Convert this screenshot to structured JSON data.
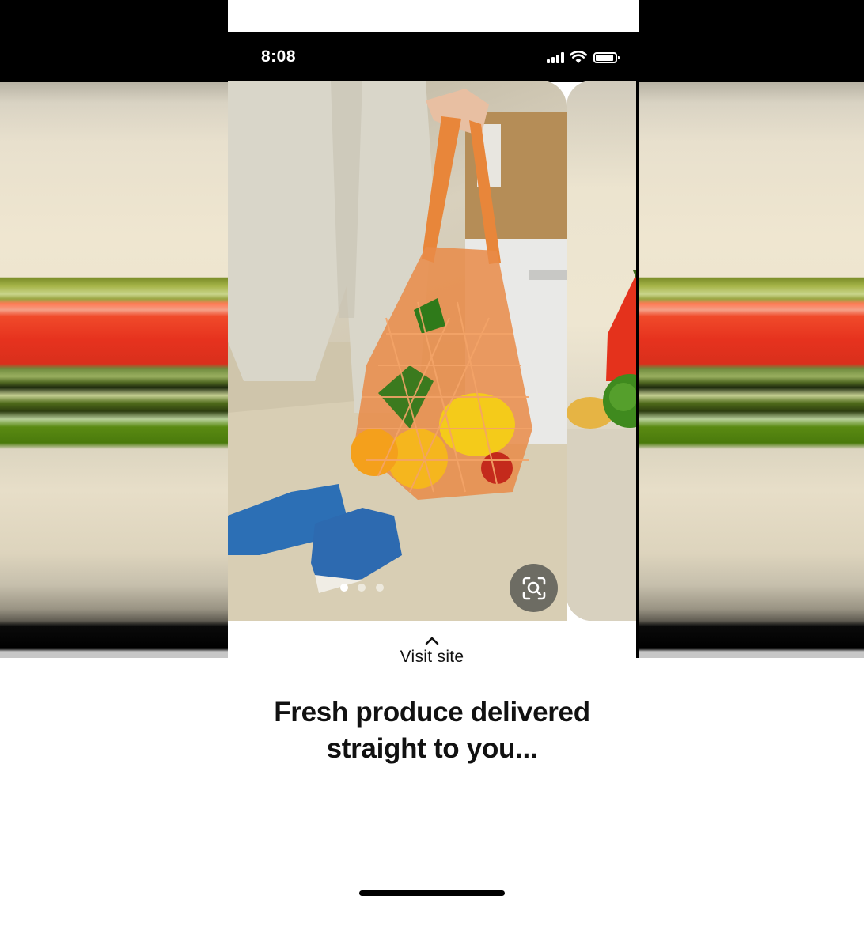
{
  "status_bar": {
    "time": "8:08",
    "signal_icon": "signal-bars-icon",
    "wifi_icon": "wifi-icon",
    "battery_icon": "battery-full-icon"
  },
  "pin": {
    "image_description_icon": "photo",
    "carousel": {
      "total": 3,
      "active_index": 0
    },
    "lens_icon": "visual-search-icon"
  },
  "sheet": {
    "visit_icon": "chevron-up-icon",
    "visit_label": "Visit site",
    "headline_line1": "Fresh produce delivered",
    "headline_line2": "straight to you..."
  },
  "colors": {
    "sheet_background": "#ffffff",
    "text": "#111111",
    "status_bar": "#000000"
  }
}
